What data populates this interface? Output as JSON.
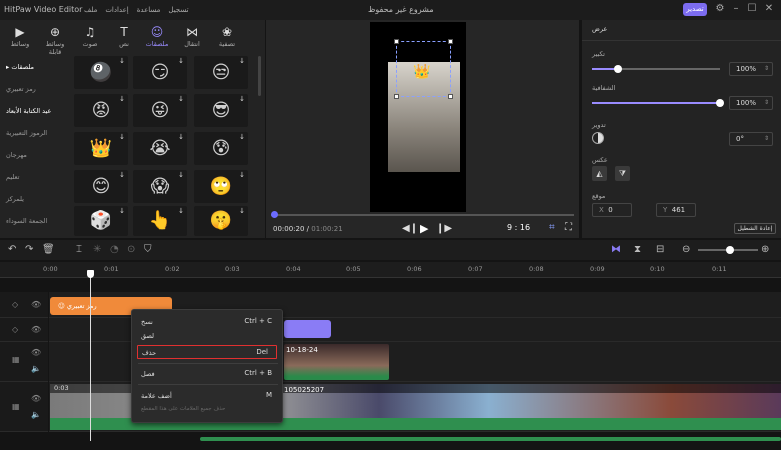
{
  "app": {
    "title": "HitPaw Video Editor",
    "project_title": "مشروع غير محفوظ",
    "menus": [
      "ملف",
      "إعدادات",
      "مساعدة",
      "تسجيل"
    ],
    "export_label": "تصدير"
  },
  "tabs": [
    {
      "label": "وسائط",
      "icon": "media-icon"
    },
    {
      "label": "وسائط قابلة",
      "icon": "globe-icon"
    },
    {
      "label": "صوت",
      "icon": "music-icon"
    },
    {
      "label": "نص",
      "icon": "text-icon"
    },
    {
      "label": "ملصقات",
      "icon": "sticker-icon",
      "active": true
    },
    {
      "label": "انتقال",
      "icon": "transition-icon"
    },
    {
      "label": "تصفية",
      "icon": "filter-icon"
    }
  ],
  "categories": [
    "ملصقات",
    "رمز تعبيري",
    "عيد الكتابة الأبعاد",
    "الرموز التعبيرية",
    "مهرجان",
    "تعليم",
    "يلمركز",
    "الجمعة السوداء"
  ],
  "stickers": [
    "🎱",
    "😏",
    "😒",
    "😡",
    "😜",
    "😎",
    "👑",
    "😭",
    "😰",
    "😊",
    "😱",
    "🙄",
    "🎲",
    "👆",
    "🤫"
  ],
  "preview": {
    "time_current": "00:00:20",
    "time_total": "01:00:21",
    "aspect_ratio": "9 : 16"
  },
  "right_panel": {
    "header": "عرض",
    "scale_label": "تكبير",
    "scale_value": "100%",
    "scale_level": 0.2,
    "opacity_label": "الشفافية",
    "opacity_value": "100%",
    "opacity_level": 1.0,
    "rotate_label": "تدوير",
    "rotate_value": "0°",
    "flip_label": "عكس",
    "position_label": "موقع",
    "x_label": "X",
    "x_value": "0",
    "y_label": "Y",
    "y_value": "461",
    "reset_label": "إعادة الشطيل"
  },
  "ruler": [
    "0:00",
    "0:01",
    "0:02",
    "0:03",
    "0:04",
    "0:05",
    "0:06",
    "0:07",
    "0:08",
    "0:09",
    "0:10",
    "0:11"
  ],
  "timeline": {
    "sticker_clip_label": "رمز تعبيري",
    "video_clip_label": "10-18-24",
    "main_clip_time": "0:03",
    "main_clip_label": "105025207"
  },
  "context_menu": {
    "items": [
      {
        "label": "نسخ",
        "shortcut": "Ctrl + C"
      },
      {
        "label": "لصق",
        "shortcut": ""
      },
      {
        "label": "حذف",
        "shortcut": "Del",
        "highlight": true
      },
      {
        "label": "فصل",
        "shortcut": "Ctrl + B"
      },
      {
        "label": "أضف علامة",
        "shortcut": "M"
      },
      {
        "label": "حذف جميع العلامات على هذا المقطع",
        "shortcut": "",
        "disabled": true
      }
    ]
  }
}
